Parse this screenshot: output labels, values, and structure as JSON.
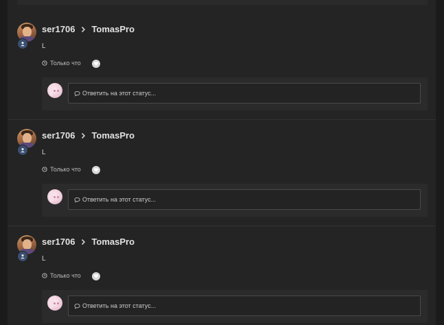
{
  "posts": [
    {
      "author": "ser1706",
      "target": "TomasPro",
      "text": "L",
      "time": "Только что",
      "reply_placeholder": "Ответить на этот статус..."
    },
    {
      "author": "ser1706",
      "target": "TomasPro",
      "text": "L",
      "time": "Только что",
      "reply_placeholder": "Ответить на этот статус..."
    },
    {
      "author": "ser1706",
      "target": "TomasPro",
      "text": "L",
      "time": "Только что",
      "reply_placeholder": "Ответить на этот статус..."
    }
  ],
  "icons": {
    "badge": "user-icon",
    "separator": "chevron-right-icon",
    "time": "clock-icon",
    "like": "heart-icon",
    "reply": "speech-bubble-icon"
  },
  "colors": {
    "background": "#1b1b1b",
    "panel": "#242424",
    "reply_box": "#2b2b2b",
    "text": "#e3e3e3",
    "badge": "#3a4f70"
  }
}
